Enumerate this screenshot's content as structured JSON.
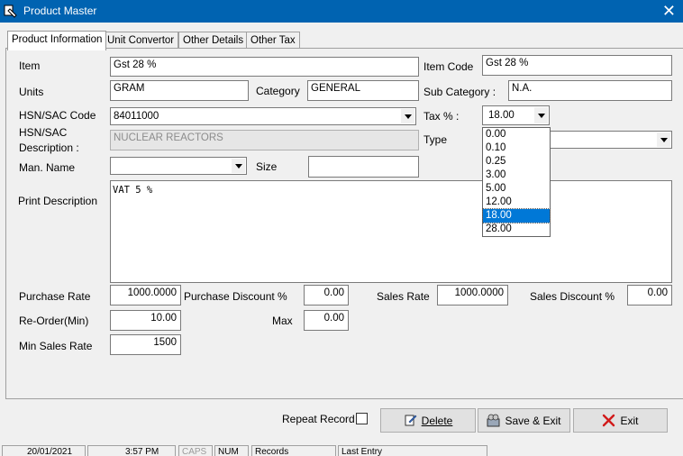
{
  "window": {
    "title": "Product Master",
    "close_glyph": "✕"
  },
  "tabs": [
    {
      "label": "Product Information"
    },
    {
      "label": "Unit Convertor"
    },
    {
      "label": "Other Details"
    },
    {
      "label": "Other Tax"
    }
  ],
  "form": {
    "item": {
      "label": "Item",
      "value": "Gst 28 %"
    },
    "item_code": {
      "label": "Item Code",
      "value": "Gst 28 %"
    },
    "units": {
      "label": "Units",
      "value": "GRAM"
    },
    "category": {
      "label": "Category",
      "value": "GENERAL"
    },
    "sub_category": {
      "label": "Sub Category :",
      "value": "N.A."
    },
    "hsn": {
      "label": "HSN/SAC Code",
      "value": "84011000"
    },
    "tax": {
      "label": "Tax % :",
      "value": "18.00",
      "options": [
        "0.00",
        "0.10",
        "0.25",
        "3.00",
        "5.00",
        "12.00",
        "18.00",
        "28.00"
      ],
      "selected_index": 6
    },
    "hsn_desc": {
      "label_line1": "HSN/SAC",
      "label_line2": "Description :",
      "value": "NUCLEAR REACTORS"
    },
    "type": {
      "label": "Type",
      "value": ""
    },
    "man_name": {
      "label": "Man. Name",
      "value": ""
    },
    "size": {
      "label": "Size",
      "value": ""
    },
    "print_desc": {
      "label": "Print Description",
      "value": "VAT 5 %"
    },
    "purchase_rate": {
      "label": "Purchase Rate",
      "value": "1000.0000"
    },
    "purchase_discount": {
      "label": "Purchase Discount %",
      "value": "0.00"
    },
    "sales_rate": {
      "label": "Sales Rate",
      "value": "1000.0000"
    },
    "sales_discount": {
      "label": "Sales Discount %",
      "value": "0.00"
    },
    "reorder_min": {
      "label": "Re-Order(Min)",
      "value": "10.00"
    },
    "max": {
      "label": "Max",
      "value": "0.00"
    },
    "min_sales_rate": {
      "label": "Min Sales Rate",
      "value": "1500"
    }
  },
  "footer": {
    "repeat_record_label": "Repeat Record",
    "repeat_record_checked": false,
    "delete_label": "Delete",
    "save_exit_label": "Save & Exit",
    "exit_label": "Exit"
  },
  "statusbar": {
    "date": "20/01/2021",
    "time": "3:57 PM",
    "caps": "CAPS",
    "num": "NUM",
    "records": "Records",
    "last_entry": "Last Entry"
  },
  "colors": {
    "titlebar": "#0063b1",
    "selection": "#0078d7",
    "exit_icon": "#d11a1a"
  }
}
